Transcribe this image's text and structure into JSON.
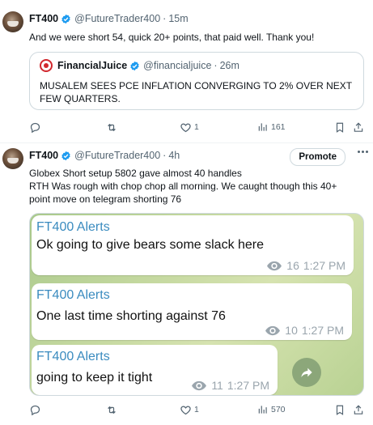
{
  "post1": {
    "name": "FT400",
    "handle": "@FutureTrader400",
    "separator": "·",
    "time": "15m",
    "text": "And we were short 54, quick 20+ points, that paid well. Thank you!",
    "quote": {
      "name": "FinancialJuice",
      "handle": "@financialjuice",
      "separator": "·",
      "time": "26m",
      "text_line1": "MUSALEM SEES PCE INFLATION CONVERGING TO 2% OVER NEXT",
      "text_line2": "FEW QUARTERS."
    },
    "actions": {
      "replies": "",
      "reposts": "",
      "likes": "1",
      "views": "161"
    }
  },
  "post2": {
    "name": "FT400",
    "handle": "@FutureTrader400",
    "separator": "·",
    "time": "4h",
    "promote_label": "Promote",
    "text_line1": "Globex Short setup 5802 gave almost 40 handles",
    "text_line2": "RTH Was rough with chop chop all morning. We caught though this 40+",
    "text_line3": "point move on telegram shorting 76",
    "media": {
      "messages": [
        {
          "title": "FT400 Alerts",
          "body": "Ok going to give bears some slack here",
          "views": "16",
          "time": "1:27 PM"
        },
        {
          "title": "FT400 Alerts",
          "body": "One last time shorting against 76",
          "views": "10",
          "time": "1:27 PM"
        },
        {
          "title": "FT400 Alerts",
          "body": "going to keep it tight",
          "views": "11",
          "time": "1:27 PM"
        }
      ]
    },
    "actions": {
      "replies": "",
      "reposts": "",
      "likes": "1",
      "views": "570"
    }
  },
  "colors": {
    "verified": "#1d9bf0",
    "muted": "#536471",
    "telegram_title": "#3a8bbf",
    "border": "#cfd9de"
  }
}
